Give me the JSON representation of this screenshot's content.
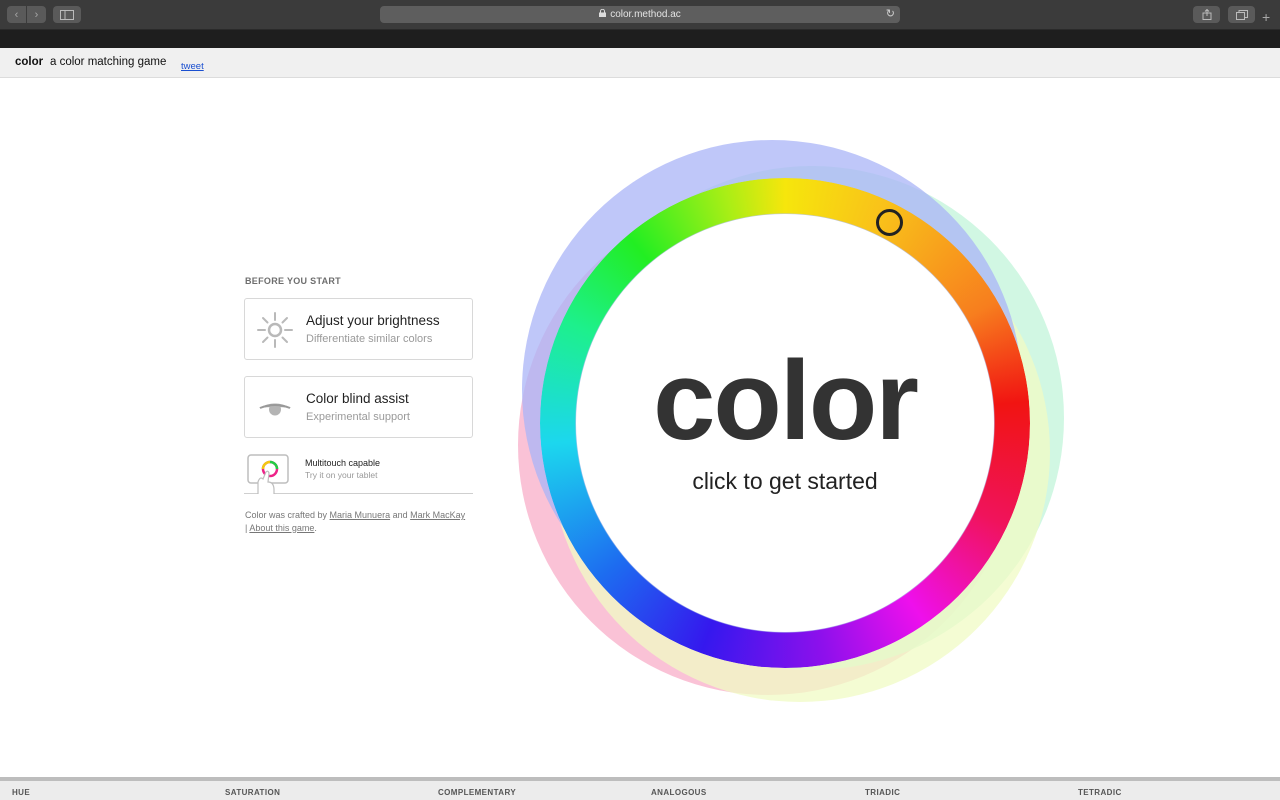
{
  "browser": {
    "url": "color.method.ac",
    "icons": {
      "back": "chevron-left-icon",
      "forward": "chevron-right-icon",
      "sidebar": "sidebar-icon",
      "lock": "lock-icon",
      "reload": "reload-icon",
      "share": "share-icon",
      "tabs": "tabs-icon",
      "new_tab": "plus-icon"
    }
  },
  "header": {
    "brand": "color",
    "tagline": "a color matching game",
    "tweet": "tweet"
  },
  "sidebar": {
    "heading": "BEFORE YOU START",
    "cards": [
      {
        "title": "Adjust your brightness",
        "subtitle": "Differentiate similar colors",
        "icon": "sun-icon"
      },
      {
        "title": "Color blind assist",
        "subtitle": "Experimental support",
        "icon": "eye-icon"
      }
    ],
    "multitouch": {
      "title": "Multitouch capable",
      "subtitle": "Try it on your tablet",
      "icon": "tablet-icon"
    },
    "credits": {
      "prefix": "Color was crafted by ",
      "author1": "Maria Munuera",
      "and": " and ",
      "author2": "Mark MacKay",
      "sep": "| ",
      "about": "About this game",
      "suffix": "."
    }
  },
  "wheel": {
    "title": "color",
    "subtitle": "click to get started",
    "colors": {
      "blue_ring": "#a9b4f7",
      "pink_ring": "#f9b3cc",
      "green_ring": "#c6f5dc",
      "yellow_ring": "#f0fbc4"
    }
  },
  "bottom_tabs": [
    "HUE",
    "SATURATION",
    "COMPLEMENTARY",
    "ANALOGOUS",
    "TRIADIC",
    "TETRADIC"
  ]
}
